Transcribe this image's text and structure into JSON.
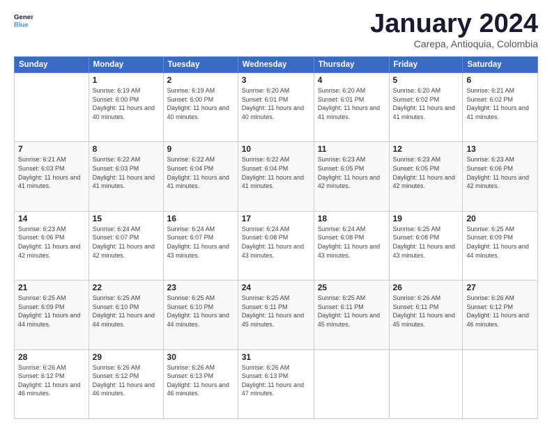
{
  "logo": {
    "text_general": "General",
    "text_blue": "Blue"
  },
  "title": "January 2024",
  "subtitle": "Carepa, Antioquia, Colombia",
  "headers": [
    "Sunday",
    "Monday",
    "Tuesday",
    "Wednesday",
    "Thursday",
    "Friday",
    "Saturday"
  ],
  "weeks": [
    [
      {
        "day": "",
        "sunrise": "",
        "sunset": "",
        "daylight": ""
      },
      {
        "day": "1",
        "sunrise": "Sunrise: 6:19 AM",
        "sunset": "Sunset: 6:00 PM",
        "daylight": "Daylight: 11 hours and 40 minutes."
      },
      {
        "day": "2",
        "sunrise": "Sunrise: 6:19 AM",
        "sunset": "Sunset: 6:00 PM",
        "daylight": "Daylight: 11 hours and 40 minutes."
      },
      {
        "day": "3",
        "sunrise": "Sunrise: 6:20 AM",
        "sunset": "Sunset: 6:01 PM",
        "daylight": "Daylight: 11 hours and 40 minutes."
      },
      {
        "day": "4",
        "sunrise": "Sunrise: 6:20 AM",
        "sunset": "Sunset: 6:01 PM",
        "daylight": "Daylight: 11 hours and 41 minutes."
      },
      {
        "day": "5",
        "sunrise": "Sunrise: 6:20 AM",
        "sunset": "Sunset: 6:02 PM",
        "daylight": "Daylight: 11 hours and 41 minutes."
      },
      {
        "day": "6",
        "sunrise": "Sunrise: 6:21 AM",
        "sunset": "Sunset: 6:02 PM",
        "daylight": "Daylight: 11 hours and 41 minutes."
      }
    ],
    [
      {
        "day": "7",
        "sunrise": "Sunrise: 6:21 AM",
        "sunset": "Sunset: 6:03 PM",
        "daylight": "Daylight: 11 hours and 41 minutes."
      },
      {
        "day": "8",
        "sunrise": "Sunrise: 6:22 AM",
        "sunset": "Sunset: 6:03 PM",
        "daylight": "Daylight: 11 hours and 41 minutes."
      },
      {
        "day": "9",
        "sunrise": "Sunrise: 6:22 AM",
        "sunset": "Sunset: 6:04 PM",
        "daylight": "Daylight: 11 hours and 41 minutes."
      },
      {
        "day": "10",
        "sunrise": "Sunrise: 6:22 AM",
        "sunset": "Sunset: 6:04 PM",
        "daylight": "Daylight: 11 hours and 41 minutes."
      },
      {
        "day": "11",
        "sunrise": "Sunrise: 6:23 AM",
        "sunset": "Sunset: 6:05 PM",
        "daylight": "Daylight: 11 hours and 42 minutes."
      },
      {
        "day": "12",
        "sunrise": "Sunrise: 6:23 AM",
        "sunset": "Sunset: 6:05 PM",
        "daylight": "Daylight: 11 hours and 42 minutes."
      },
      {
        "day": "13",
        "sunrise": "Sunrise: 6:23 AM",
        "sunset": "Sunset: 6:06 PM",
        "daylight": "Daylight: 11 hours and 42 minutes."
      }
    ],
    [
      {
        "day": "14",
        "sunrise": "Sunrise: 6:23 AM",
        "sunset": "Sunset: 6:06 PM",
        "daylight": "Daylight: 11 hours and 42 minutes."
      },
      {
        "day": "15",
        "sunrise": "Sunrise: 6:24 AM",
        "sunset": "Sunset: 6:07 PM",
        "daylight": "Daylight: 11 hours and 42 minutes."
      },
      {
        "day": "16",
        "sunrise": "Sunrise: 6:24 AM",
        "sunset": "Sunset: 6:07 PM",
        "daylight": "Daylight: 11 hours and 43 minutes."
      },
      {
        "day": "17",
        "sunrise": "Sunrise: 6:24 AM",
        "sunset": "Sunset: 6:08 PM",
        "daylight": "Daylight: 11 hours and 43 minutes."
      },
      {
        "day": "18",
        "sunrise": "Sunrise: 6:24 AM",
        "sunset": "Sunset: 6:08 PM",
        "daylight": "Daylight: 11 hours and 43 minutes."
      },
      {
        "day": "19",
        "sunrise": "Sunrise: 6:25 AM",
        "sunset": "Sunset: 6:08 PM",
        "daylight": "Daylight: 11 hours and 43 minutes."
      },
      {
        "day": "20",
        "sunrise": "Sunrise: 6:25 AM",
        "sunset": "Sunset: 6:09 PM",
        "daylight": "Daylight: 11 hours and 44 minutes."
      }
    ],
    [
      {
        "day": "21",
        "sunrise": "Sunrise: 6:25 AM",
        "sunset": "Sunset: 6:09 PM",
        "daylight": "Daylight: 11 hours and 44 minutes."
      },
      {
        "day": "22",
        "sunrise": "Sunrise: 6:25 AM",
        "sunset": "Sunset: 6:10 PM",
        "daylight": "Daylight: 11 hours and 44 minutes."
      },
      {
        "day": "23",
        "sunrise": "Sunrise: 6:25 AM",
        "sunset": "Sunset: 6:10 PM",
        "daylight": "Daylight: 11 hours and 44 minutes."
      },
      {
        "day": "24",
        "sunrise": "Sunrise: 6:25 AM",
        "sunset": "Sunset: 6:11 PM",
        "daylight": "Daylight: 11 hours and 45 minutes."
      },
      {
        "day": "25",
        "sunrise": "Sunrise: 6:25 AM",
        "sunset": "Sunset: 6:11 PM",
        "daylight": "Daylight: 11 hours and 45 minutes."
      },
      {
        "day": "26",
        "sunrise": "Sunrise: 6:26 AM",
        "sunset": "Sunset: 6:11 PM",
        "daylight": "Daylight: 11 hours and 45 minutes."
      },
      {
        "day": "27",
        "sunrise": "Sunrise: 6:26 AM",
        "sunset": "Sunset: 6:12 PM",
        "daylight": "Daylight: 11 hours and 46 minutes."
      }
    ],
    [
      {
        "day": "28",
        "sunrise": "Sunrise: 6:26 AM",
        "sunset": "Sunset: 6:12 PM",
        "daylight": "Daylight: 11 hours and 46 minutes."
      },
      {
        "day": "29",
        "sunrise": "Sunrise: 6:26 AM",
        "sunset": "Sunset: 6:12 PM",
        "daylight": "Daylight: 11 hours and 46 minutes."
      },
      {
        "day": "30",
        "sunrise": "Sunrise: 6:26 AM",
        "sunset": "Sunset: 6:13 PM",
        "daylight": "Daylight: 11 hours and 46 minutes."
      },
      {
        "day": "31",
        "sunrise": "Sunrise: 6:26 AM",
        "sunset": "Sunset: 6:13 PM",
        "daylight": "Daylight: 11 hours and 47 minutes."
      },
      {
        "day": "",
        "sunrise": "",
        "sunset": "",
        "daylight": ""
      },
      {
        "day": "",
        "sunrise": "",
        "sunset": "",
        "daylight": ""
      },
      {
        "day": "",
        "sunrise": "",
        "sunset": "",
        "daylight": ""
      }
    ]
  ]
}
